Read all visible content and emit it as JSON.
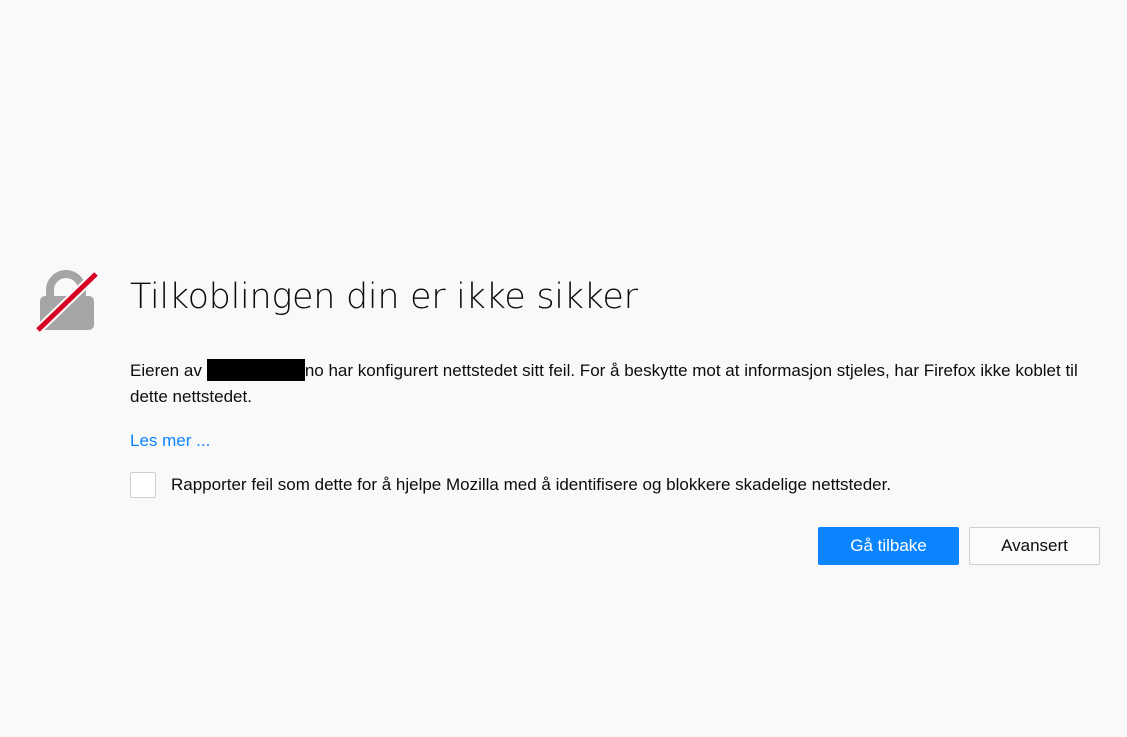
{
  "error": {
    "title": "Tilkoblingen din er ikke sikker",
    "description": {
      "prefix": "Eieren av",
      "redacted_domain": "",
      "suffix": "no har konfigurert nettstedet sitt feil. For å beskytte mot at informasjon stjeles, har Firefox ikke koblet til dette nettstedet."
    },
    "learn_more": "Les mer ...",
    "report_checkbox": {
      "checked": false,
      "label": "Rapporter feil som dette for å hjelpe Mozilla med å identifisere og blokkere skadelige nettsteder."
    }
  },
  "buttons": {
    "go_back": "Gå tilbake",
    "advanced": "Avansert"
  },
  "icon": {
    "name": "broken-lock-icon",
    "lock_color": "#a5a5a5",
    "slash_color": "#d70022"
  },
  "colors": {
    "background": "#f9f9f9",
    "accent": "#0a84ff",
    "text": "#0c0c0d"
  }
}
